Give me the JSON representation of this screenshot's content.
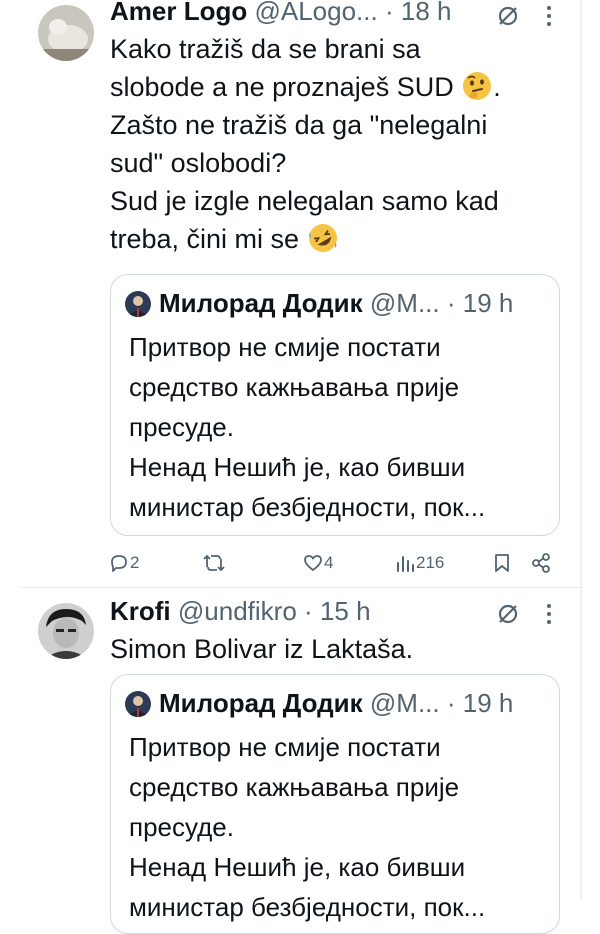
{
  "tweets": [
    {
      "author": "Amer Logo",
      "handle": "@ALogo...",
      "sep": "·",
      "time": "18 h",
      "lines": [
        "Kako tražiš da se brani sa",
        "slobode a ne proznaješ SUD",
        "Zašto ne tražiš da ga \"nelegalni",
        "sud\" oslobodi?",
        "Sud je izgle nelegalan samo kad",
        "treba, čini mi se"
      ],
      "line2_suffix": ".",
      "emoji_1": "thinking-face",
      "emoji_2": "rolling-laughing-face",
      "quote": {
        "author": "Милорад Додик",
        "handle": "@М...",
        "sep": "·",
        "time": "19 h",
        "lines": [
          "Притвор не смије постати",
          "средство кажњавања прије",
          "пресуде.",
          "Ненад Нешић је, као бивши",
          "министар безбједности, пок..."
        ]
      },
      "actions": {
        "replies": "2",
        "reposts": "",
        "likes": "4",
        "views": "216"
      }
    },
    {
      "author": "Krofi",
      "handle": "@undfikro",
      "sep": "·",
      "time": "15 h",
      "lines": [
        "Simon Bolivar iz Laktaša."
      ],
      "quote": {
        "author": "Милорад Додик",
        "handle": "@М...",
        "sep": "·",
        "time": "19 h",
        "lines": [
          "Притвор не смије постати",
          "средство кажњавања прије",
          "пресуде.",
          "Ненад Нешић је, као бивши",
          "министар безбједности, пок..."
        ]
      }
    }
  ],
  "colors": {
    "text": "#0f1419",
    "muted": "#536471",
    "border": "#cfd9de"
  }
}
